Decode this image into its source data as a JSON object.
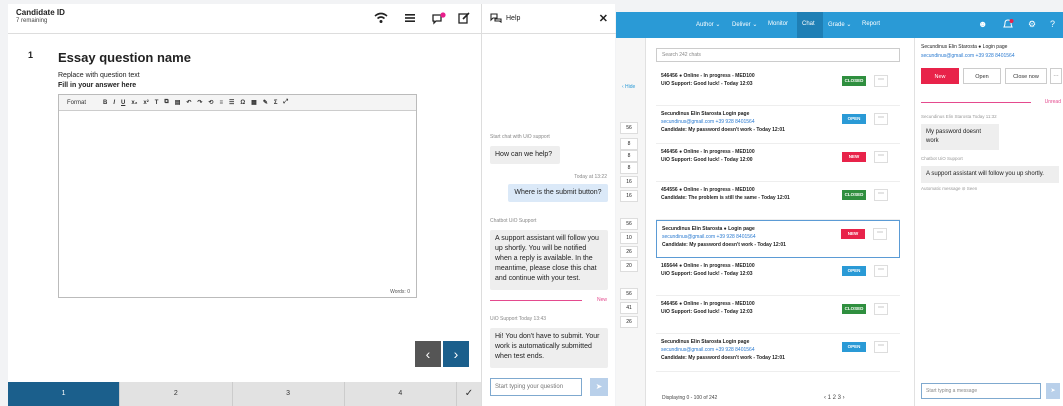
{
  "exam": {
    "candidate_id": "Candidate ID",
    "remaining": "7 remaining",
    "question_number": "1",
    "question_title": "Essay question name",
    "question_text": "Replace with question text",
    "fill_label": "Fill in your answer here",
    "editor_format": "Format",
    "words": "Words: 0",
    "pages": [
      "1",
      "2",
      "3",
      "4"
    ],
    "check": "✓"
  },
  "help": {
    "title": "Help",
    "start_label": "Start chat with UiO support",
    "q1": "How can we help?",
    "time1": "Today at 13:22",
    "user_msg": "Where is the submit button?",
    "bot_label": "Chatbot UiO Support",
    "bot_msg": "A support assistant will follow you up shortly. You will be notified when a reply is available. In the meantime, please close this chat and continue with your test.",
    "new_label": "New",
    "support_label": "UiO Support Today 13:43",
    "support_msg": "Hi! You don't have to submit. Your work is automatically submitted when test ends.",
    "input_placeholder": "Start typing your question"
  },
  "admin": {
    "nav": [
      "Author ⌄",
      "Deliver ⌄",
      "Monitor",
      "Chat",
      "Grade ⌄",
      "Report"
    ],
    "hide": "‹ Hide",
    "left_numbers": [
      "56",
      "8",
      "8",
      "8",
      "16",
      "16",
      "56",
      "10",
      "26",
      "20",
      "56",
      "41",
      "26"
    ],
    "search_placeholder": "Search 242 chats",
    "cards": [
      {
        "l1": "546456  ●  Online  -  In progress  -  MED100",
        "l2": "UiO Support: Good luck!  -  Today 12:03",
        "l3": "",
        "badge": "CLOSED",
        "badge_color": "#2f8f3f"
      },
      {
        "l1": "Secundinus Elin Starosta     Login page",
        "l2": "secundinus@gmail.com     +39 928 8401564",
        "l3": "Candidate: My password doesn't work  -  Today 12:01",
        "badge": "OPEN",
        "badge_color": "#2a9ad6"
      },
      {
        "l1": "546456  ●  Online  -  In progress  -  MED100",
        "l2": "UiO Support: Good luck!  -  Today 12:00",
        "l3": "",
        "badge": "NEW",
        "badge_color": "#e8234a"
      },
      {
        "l1": "454556  ●  Online  -  In progress  -  MED100",
        "l2": "Candidate: The problem is still the same  -  Today 12:01",
        "l3": "",
        "badge": "CLOSED",
        "badge_color": "#2f8f3f"
      },
      {
        "l1": "Secundinus Elin Starosta  ●  Login page",
        "l2": "secundinus@gmail.com     +39 928 8401564",
        "l3": "Candidate: My password doesn't work  -  Today 12:01",
        "badge": "NEW",
        "badge_color": "#e8234a"
      },
      {
        "l1": "165644  ●  Online  -  In progress  -  MED100",
        "l2": "UiO Support: Good luck!  -  Today 12:03",
        "l3": "",
        "badge": "OPEN",
        "badge_color": "#2a9ad6"
      },
      {
        "l1": "546456  ●  Online  -  In progress  -  MED100",
        "l2": "UiO Support: Good luck!  -  Today 12:03",
        "l3": "",
        "badge": "CLOSED",
        "badge_color": "#2f8f3f"
      },
      {
        "l1": "Secundinus Elin Starosta     Login page",
        "l2": "secundinus@gmail.com     +39 928 8401564",
        "l3": "Candidate: My password doesn't work  -  Today 12:01",
        "badge": "OPEN",
        "badge_color": "#2a9ad6"
      }
    ],
    "displaying": "Displaying 0 - 100 of 242",
    "pagination": "‹   1     2     3   ›",
    "right_name": "Secundinus Elin Starosta  ●  Login page",
    "right_email": "secundinus@gmail.com     +39 928 8401564",
    "btn_new": "New",
    "btn_open": "Open",
    "btn_close": "Close now",
    "unread": "Unread",
    "meta1": "Secundinus Elin Starosta Today 11:32",
    "msg1": "My password doesnt work",
    "meta2": "Chatbot UiO Support",
    "msg2": "A support assistant will follow you up shortly.",
    "meta3": "Automatic message  ⊘  Seen",
    "input_placeholder": "Start typing a message"
  }
}
